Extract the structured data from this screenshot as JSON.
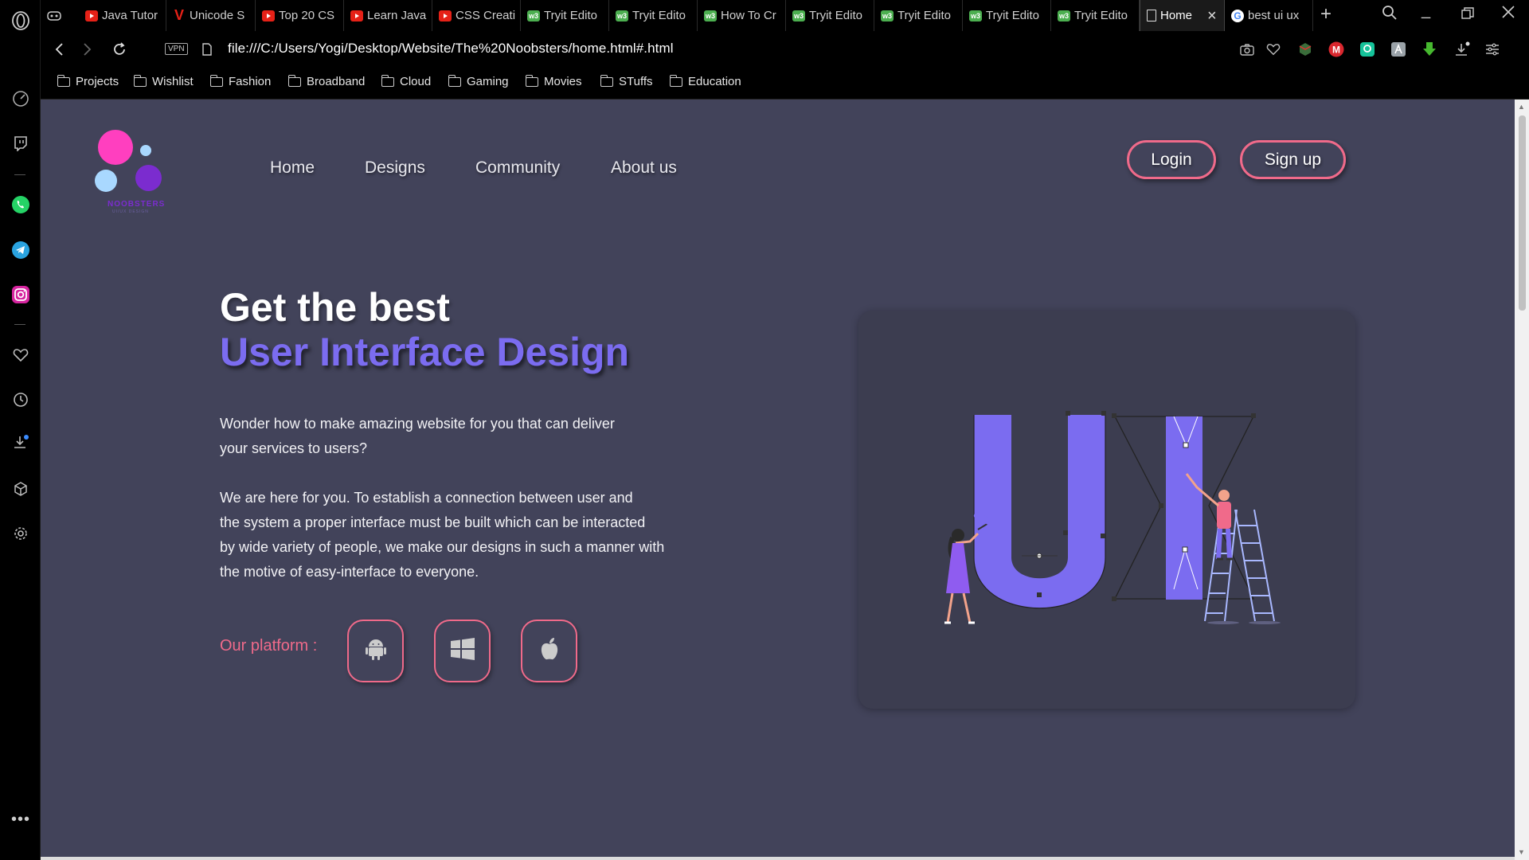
{
  "browser": {
    "tabs": [
      {
        "title": "Java Tutor",
        "favicon": "youtube-icon"
      },
      {
        "title": "Unicode S",
        "favicon": "vivaldi-icon"
      },
      {
        "title": "Top 20 CS",
        "favicon": "youtube-icon"
      },
      {
        "title": "Learn Java",
        "favicon": "youtube-icon"
      },
      {
        "title": "CSS Creati",
        "favicon": "youtube-icon"
      },
      {
        "title": "Tryit Edito",
        "favicon": "w3schools-icon"
      },
      {
        "title": "Tryit Edito",
        "favicon": "w3schools-icon"
      },
      {
        "title": "How To Cr",
        "favicon": "w3schools-icon"
      },
      {
        "title": "Tryit Edito",
        "favicon": "w3schools-icon"
      },
      {
        "title": "Tryit Edito",
        "favicon": "w3schools-icon"
      },
      {
        "title": "Tryit Edito",
        "favicon": "w3schools-icon"
      },
      {
        "title": "Tryit Edito",
        "favicon": "w3schools-icon"
      },
      {
        "title": "Home",
        "favicon": "document-icon",
        "active": true
      },
      {
        "title": "best ui ux",
        "favicon": "google-icon"
      }
    ],
    "w3_badge": "w3",
    "vpn_label": "VPN",
    "url": "file:///C:/Users/Yogi/Desktop/Website/The%20Noobsters/home.html#.html",
    "bookmarks": [
      "Projects",
      "Wishlist",
      "Fashion",
      "Broadband",
      "Cloud",
      "Gaming",
      "Movies",
      "STuffs",
      "Education"
    ],
    "extension_badge": "M"
  },
  "site": {
    "logo_text": "NOOBSTERS",
    "logo_subtext": "UI/UX DESIGN",
    "nav": [
      "Home",
      "Designs",
      "Community",
      "About us"
    ],
    "login_label": "Login",
    "signup_label": "Sign up",
    "hero": {
      "title": "Get the best",
      "highlight": "User Interface Design",
      "para1_line1": "Wonder how to make amazing website for you that can deliver",
      "para1_line2": "your services to users?",
      "para2_line1": "We are here for you. To establish a connection between user and",
      "para2_line2": "the system a proper interface must be built which can be interacted",
      "para2_line3": "by wide variety of people, we make our designs in such a manner with",
      "para2_line4": "the motive of easy-interface to everyone."
    },
    "platform_label": "Our platform :",
    "platforms": [
      "android-icon",
      "windows-icon",
      "apple-icon"
    ]
  },
  "colors": {
    "page_bg": "#42435a",
    "accent_pink": "#f06a8a",
    "accent_purple": "#7b6cf0",
    "logo_pink": "#ff3fbf",
    "logo_purple": "#7b2ccf",
    "logo_lightblue": "#a9d8ff"
  }
}
